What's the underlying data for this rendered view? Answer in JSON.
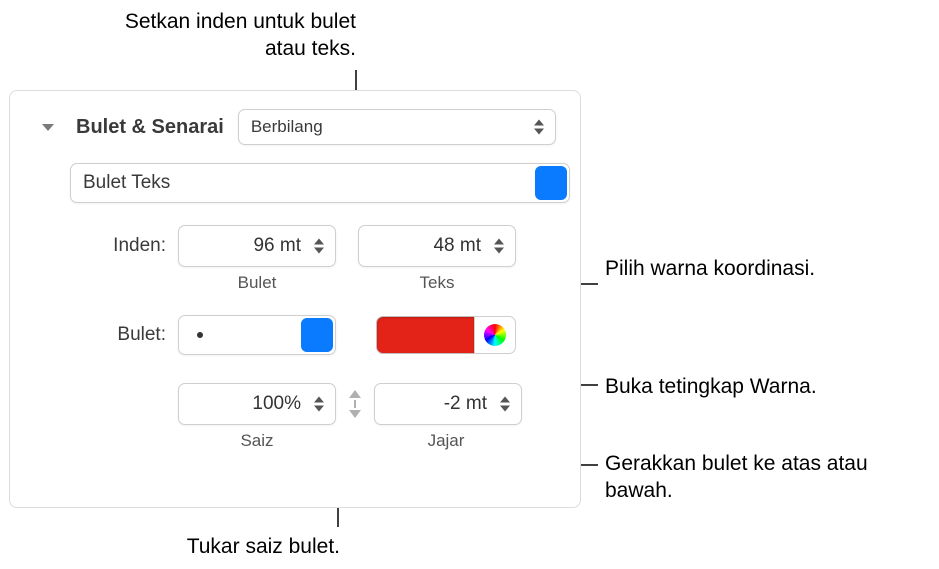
{
  "callouts": {
    "indent": "Setkan inden untuk bulet atau teks.",
    "colorSwatch": "Pilih warna koordinasi.",
    "colorWindow": "Buka tetingkap Warna.",
    "align": "Gerakkan bulet ke atas atau bawah.",
    "size": "Tukar saiz bulet."
  },
  "panel": {
    "sectionTitle": "Bulet & Senarai",
    "listStyle": "Berbilang",
    "bulletType": "Bulet Teks",
    "indent": {
      "label": "Inden:",
      "bullet": {
        "value": "96 mt",
        "caption": "Bulet"
      },
      "text": {
        "value": "48 mt",
        "caption": "Teks"
      }
    },
    "bulletRow": {
      "label": "Bulet:",
      "glyph": "•",
      "color": "#e42318"
    },
    "size": {
      "value": "100%",
      "caption": "Saiz"
    },
    "align": {
      "value": "-2 mt",
      "caption": "Jajar"
    }
  }
}
